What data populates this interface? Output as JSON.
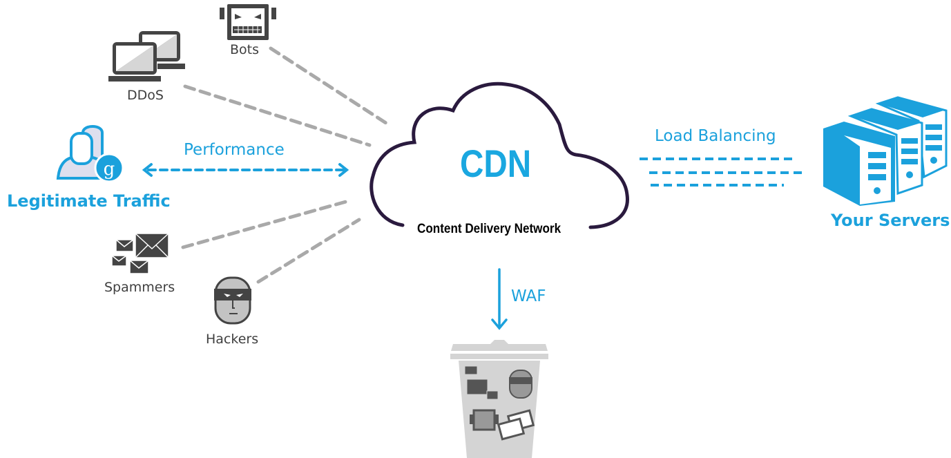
{
  "diagram": {
    "center": {
      "title": "CDN",
      "subtitle": "Content Delivery Network"
    },
    "threats": [
      {
        "id": "bots",
        "label": "Bots",
        "icon": "robot-icon"
      },
      {
        "id": "ddos",
        "label": "DDoS",
        "icon": "laptops-icon"
      },
      {
        "id": "spammers",
        "label": "Spammers",
        "icon": "envelopes-icon"
      },
      {
        "id": "hackers",
        "label": "Hackers",
        "icon": "masked-face-icon"
      }
    ],
    "legitimate": {
      "label": "Legitimate Traffic",
      "icon": "users-google-icon",
      "connection_label": "Performance"
    },
    "servers": {
      "label": "Your Servers",
      "icon": "servers-icon",
      "connection_label": "Load Balancing"
    },
    "waf": {
      "label": "WAF",
      "icon": "trash-bin-icon"
    },
    "colors": {
      "accent": "#1ba1dc",
      "threat": "#444444",
      "dash": "#a9a9a9",
      "cloud": "#2a1a3e",
      "bin": "#d4d4d4"
    }
  }
}
